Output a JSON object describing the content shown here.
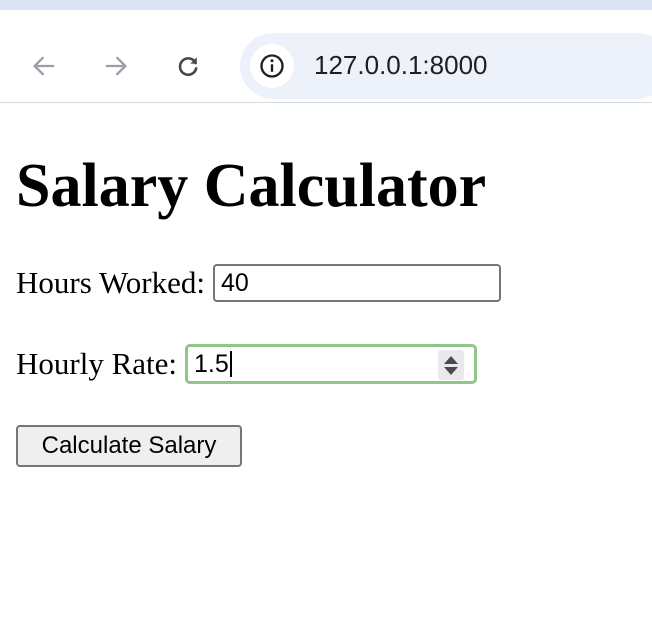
{
  "browser": {
    "url": "127.0.0.1:8000",
    "icons": {
      "back": "arrow-left",
      "forward": "arrow-right",
      "reload": "reload",
      "site_info": "info-circle"
    }
  },
  "page": {
    "title": "Salary Calculator",
    "hours": {
      "label": "Hours Worked:",
      "value": "40"
    },
    "rate": {
      "label": "Hourly Rate:",
      "value": "1.5"
    },
    "calculate_label": "Calculate Salary"
  },
  "colors": {
    "tab_strip": "#dbe4f6",
    "omnibox": "#edf2fa",
    "focus_ring": "#93c48b",
    "button_bg": "#efefef"
  }
}
